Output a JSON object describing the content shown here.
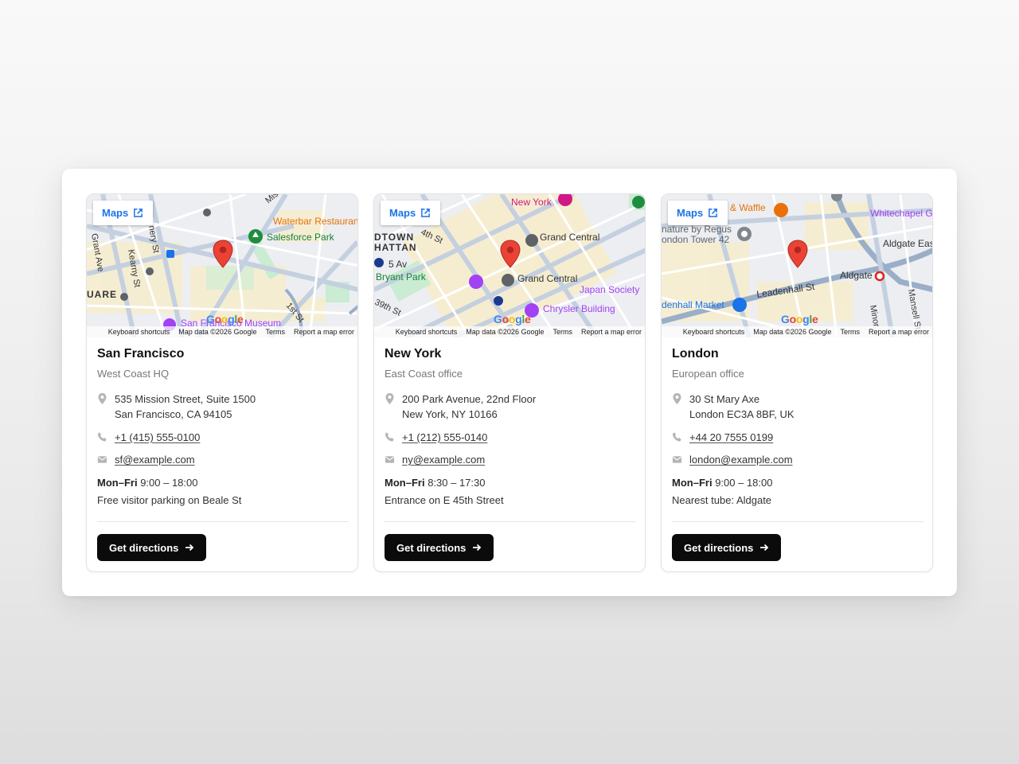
{
  "map": {
    "maps_button_label": "Maps",
    "attribution": {
      "keyboard_shortcuts": "Keyboard shortcuts",
      "map_data": "Map data ©2026 Google",
      "terms": "Terms",
      "report": "Report a map error"
    }
  },
  "offices": [
    {
      "city": "San Francisco",
      "subtitle": "West Coast HQ",
      "address_line1": "535 Mission Street, Suite 1500",
      "address_line2": "San Francisco, CA 94105",
      "phone": "+1 (415) 555-0100",
      "email": "sf@example.com",
      "hours_days": "Mon–Fri",
      "hours_time": "9:00 – 18:00",
      "note": "Free visitor parking on Beale St",
      "button_label": "Get directions"
    },
    {
      "city": "New York",
      "subtitle": "East Coast office",
      "address_line1": "200 Park Avenue, 22nd Floor",
      "address_line2": "New York, NY 10166",
      "phone": "+1 (212) 555-0140",
      "email": "ny@example.com",
      "hours_days": "Mon–Fri",
      "hours_time": "8:30 – 17:30",
      "note": "Entrance on E 45th Street",
      "button_label": "Get directions"
    },
    {
      "city": "London",
      "subtitle": "European office",
      "address_line1": "30 St Mary Axe",
      "address_line2": "London EC3A 8BF, UK",
      "phone": "+44 20 7555 0199",
      "email": "london@example.com",
      "hours_days": "Mon–Fri",
      "hours_time": "9:00 – 18:00",
      "note": "Nearest tube: Aldgate",
      "button_label": "Get directions"
    }
  ],
  "colors": {
    "accent_blue": "#1a73e8",
    "button_bg": "#0b0b0b",
    "pin_red": "#ea4335"
  }
}
